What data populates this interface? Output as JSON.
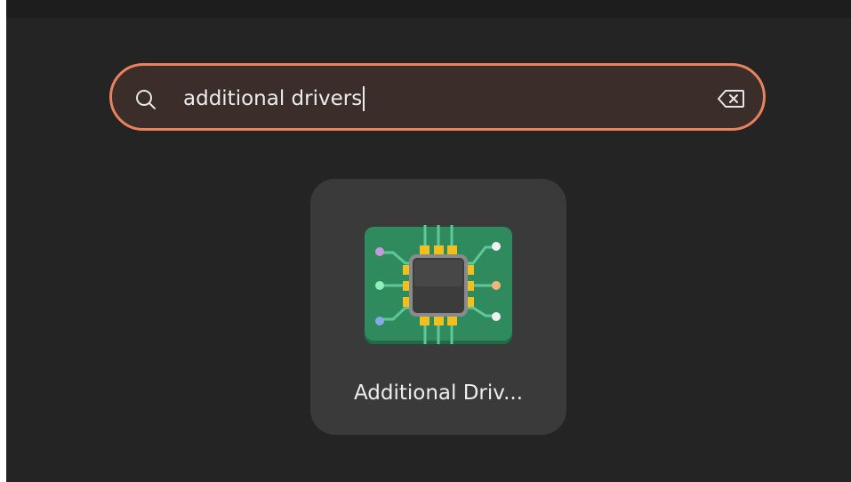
{
  "search": {
    "query": "additional drivers",
    "icon": "search-icon",
    "clear_icon": "clear-text-icon"
  },
  "results": [
    {
      "label": "Additional Driv...",
      "icon": "additional-drivers-chip-icon"
    }
  ],
  "colors": {
    "background": "#242424",
    "search_border": "#e9825f",
    "search_fill": "#3b2e2a",
    "tile_fill": "#3a3a3a",
    "board_green": "#2f8b5e",
    "chip_pins": "#f2c01e"
  }
}
